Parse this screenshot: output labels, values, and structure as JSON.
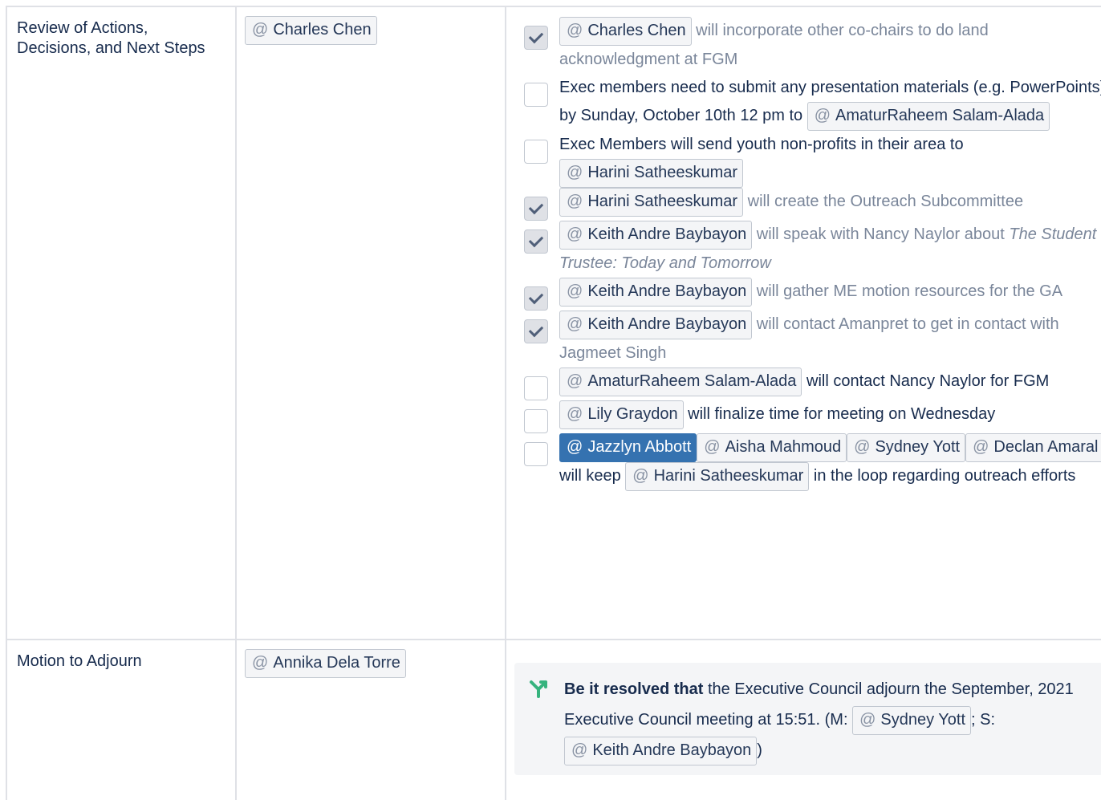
{
  "rows": [
    {
      "item": "Review of Actions, Decisions, and Next Steps",
      "owner": "Charles Chen",
      "tasks": [
        {
          "checked": true,
          "parts": [
            {
              "m": "Charles Chen"
            },
            {
              "t": " will incorporate other co-chairs to do land acknowledgment at FGM"
            }
          ]
        },
        {
          "checked": false,
          "parts": [
            {
              "t": "Exec members need to submit any presentation materials (e.g. PowerPoints) by Sunday, October 10th 12 pm to "
            },
            {
              "m": "AmaturRaheem Salam-Alada"
            }
          ]
        },
        {
          "checked": false,
          "parts": [
            {
              "t": "Exec Members will send youth non-profits in their area to "
            },
            {
              "m": "Harini Satheeskumar"
            }
          ]
        },
        {
          "checked": true,
          "parts": [
            {
              "m": "Harini Satheeskumar"
            },
            {
              "t": " will create the Outreach Subcommittee"
            }
          ]
        },
        {
          "checked": true,
          "parts": [
            {
              "m": "Keith Andre Baybayon"
            },
            {
              "t": " will speak with Nancy Naylor about "
            },
            {
              "i": "The Student Trustee: Today and Tomorrow"
            }
          ]
        },
        {
          "checked": true,
          "parts": [
            {
              "m": "Keith Andre Baybayon"
            },
            {
              "t": " will gather ME motion resources for the GA"
            }
          ]
        },
        {
          "checked": true,
          "parts": [
            {
              "m": "Keith Andre Baybayon"
            },
            {
              "t": " will contact Amanpret to get in contact with Jagmeet Singh"
            }
          ]
        },
        {
          "checked": false,
          "parts": [
            {
              "m": "AmaturRaheem Salam-Alada"
            },
            {
              "t": " will contact Nancy Naylor for FGM"
            }
          ]
        },
        {
          "checked": false,
          "parts": [
            {
              "m": "Lily Graydon"
            },
            {
              "t": " will finalize time for meeting on Wednesday"
            }
          ]
        },
        {
          "checked": false,
          "parts": [
            {
              "m": "Jazzlyn Abbott",
              "self": true
            },
            {
              "m": "Aisha Mahmoud"
            },
            {
              "m": "Sydney Yott"
            },
            {
              "m": "Declan Amaral"
            },
            {
              "t": " will keep "
            },
            {
              "m": "Harini Satheeskumar"
            },
            {
              "t": " in the loop regarding outreach efforts"
            }
          ]
        }
      ]
    },
    {
      "item": "Motion to Adjourn",
      "owner": "Annika Dela Torre",
      "decision": {
        "bold": "Be it resolved that",
        "text1": " the Executive Council adjourn the September, 2021 Executive Council meeting at 15:51. (M: ",
        "mover": "Sydney Yott",
        "text2": "; S: ",
        "seconder": "Keith Andre Baybayon",
        "text3": ")"
      }
    }
  ],
  "mention_prefix": "@",
  "colors": {
    "mention_self": "#3572b0",
    "decision_icon": "#36b37e",
    "border": "#dfe1e6"
  }
}
